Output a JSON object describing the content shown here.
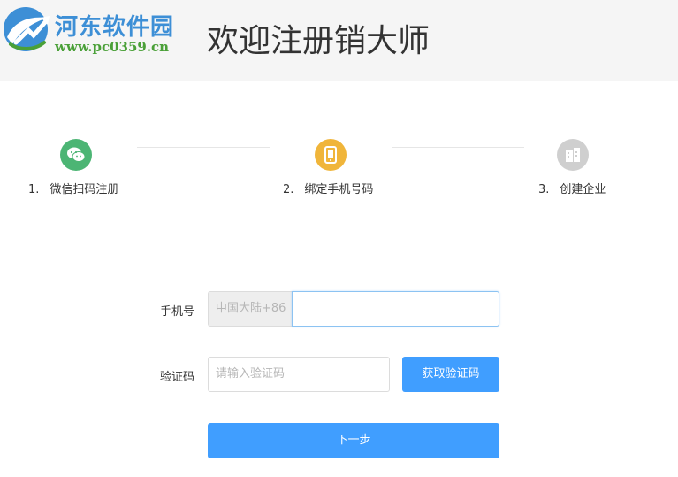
{
  "logo": {
    "name": "河东软件园",
    "url": "www.pc0359.cn"
  },
  "page": {
    "title": "欢迎注册销大师"
  },
  "steps": [
    {
      "number": "1.",
      "label": "微信扫码注册",
      "icon": "wechat-icon",
      "color": "#4cb574"
    },
    {
      "number": "2.",
      "label": "绑定手机号码",
      "icon": "mobile-phone-icon",
      "color": "#f0b53a"
    },
    {
      "number": "3.",
      "label": "创建企业",
      "icon": "building-icon",
      "color": "#cfcfcf"
    }
  ],
  "form": {
    "phone_label": "手机号",
    "country_code": "中国大陆+86",
    "phone_value": "",
    "code_label": "验证码",
    "code_placeholder": "请输入验证码",
    "get_code_label": "获取验证码",
    "next_label": "下一步"
  },
  "colors": {
    "primary": "#409eff",
    "header_bg": "#f5f5f5"
  }
}
